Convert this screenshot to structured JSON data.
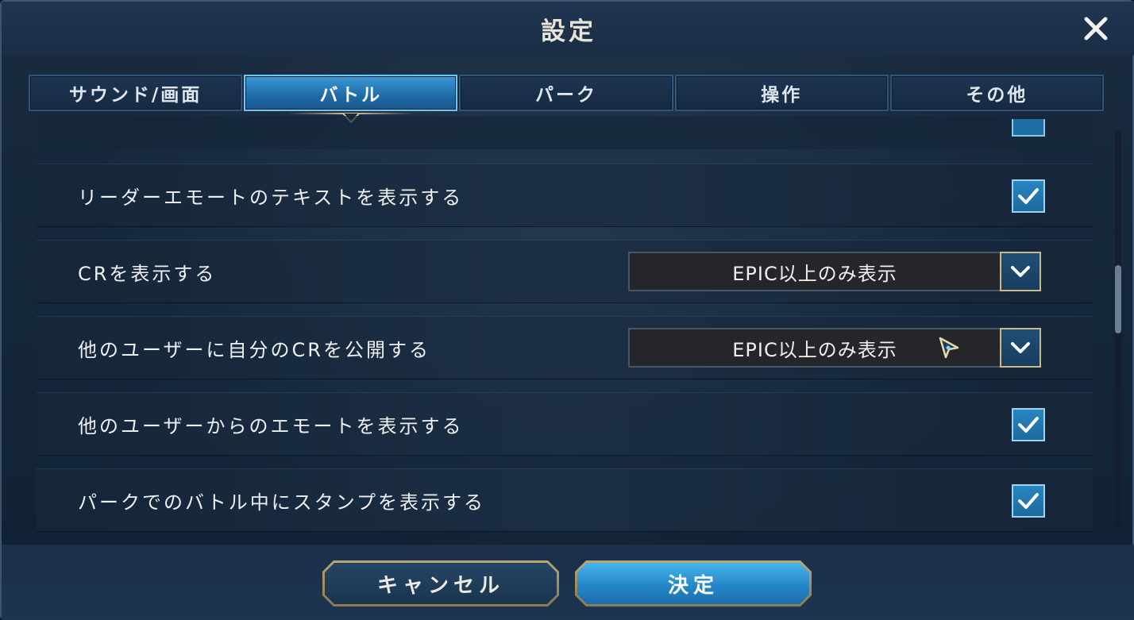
{
  "window": {
    "title": "設定",
    "close_icon": "close-icon"
  },
  "tabs": [
    {
      "label": "サウンド/画面",
      "active": false
    },
    {
      "label": "バトル",
      "active": true
    },
    {
      "label": "パーク",
      "active": false
    },
    {
      "label": "操作",
      "active": false
    },
    {
      "label": "その他",
      "active": false
    }
  ],
  "settings": {
    "leader_emote_text": {
      "label": "リーダーエモートのテキストを表示する",
      "checked": true
    },
    "show_cr": {
      "label": "CRを表示する",
      "value": "EPIC以上のみ表示"
    },
    "publish_cr": {
      "label": "他のユーザーに自分のCRを公開する",
      "value": "EPIC以上のみ表示"
    },
    "other_user_emote": {
      "label": "他のユーザーからのエモートを表示する",
      "checked": true
    },
    "park_battle_stamp": {
      "label": "パークでのバトル中にスタンプを表示する",
      "checked": true
    }
  },
  "footer": {
    "cancel_label": "キャンセル",
    "ok_label": "決定"
  },
  "colors": {
    "accent_blue": "#2a86be",
    "gold_border": "#b9a675",
    "panel_bg": "#14263a"
  }
}
